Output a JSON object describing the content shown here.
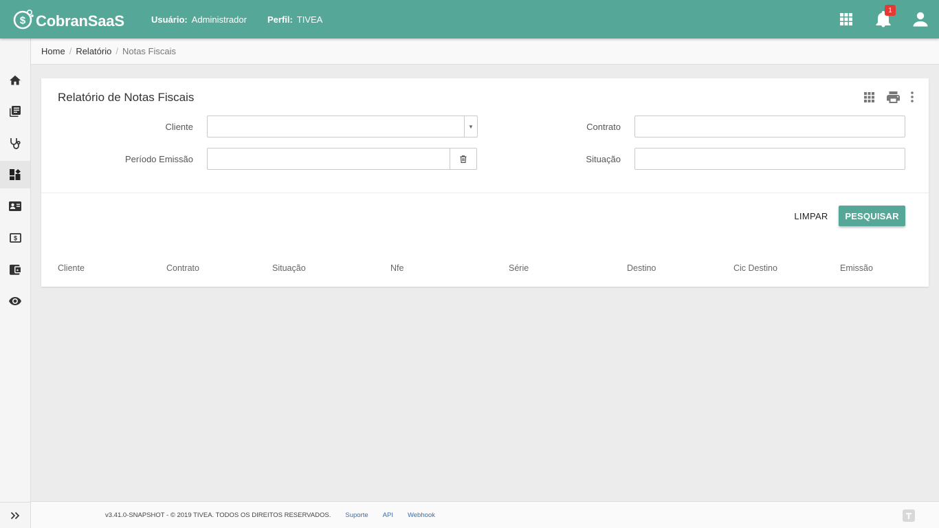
{
  "app": {
    "brand": "CobranSaaS",
    "user_label": "Usuário:",
    "user_value": "Administrador",
    "profile_label": "Perfil:",
    "profile_value": "TIVEA",
    "notification_count": "1",
    "accent_color": "#55a898"
  },
  "topbar": {
    "icons": [
      "apps-grid-icon",
      "bell-icon",
      "user-icon"
    ]
  },
  "sidebar": {
    "items": [
      {
        "icon": "home-icon"
      },
      {
        "icon": "library-books-icon"
      },
      {
        "icon": "stethoscope-icon"
      },
      {
        "icon": "dashboard-icon",
        "active": true
      },
      {
        "icon": "contact-card-icon"
      },
      {
        "icon": "money-icon"
      },
      {
        "icon": "wallet-icon"
      },
      {
        "icon": "eye-icon"
      }
    ],
    "toggle_icon": "expand-double-chevron-icon"
  },
  "breadcrumb": {
    "items": [
      "Home",
      "Relatório",
      "Notas Fiscais"
    ]
  },
  "card": {
    "title": "Relatório de Notas Fiscais",
    "tools": [
      "grid-columns-icon",
      "print-icon",
      "more-vert-icon"
    ],
    "form": {
      "cliente_label": "Cliente",
      "cliente_value": "",
      "periodo_label": "Período Emissão",
      "periodo_value": "",
      "contrato_label": "Contrato",
      "contrato_value": "",
      "situacao_label": "Situação",
      "situacao_value": ""
    },
    "buttons": {
      "limpar": "LIMPAR",
      "pesquisar": "PESQUISAR"
    },
    "table": {
      "columns": [
        "Cliente",
        "Contrato",
        "Situação",
        "Nfe",
        "Série",
        "Destino",
        "Cic Destino",
        "Emissão"
      ],
      "rows": []
    }
  },
  "footer": {
    "copyright": "v3.41.0-SNAPSHOT - © 2019 TIVEA. TODOS OS DIREITOS RESERVADOS.",
    "links": [
      "Suporte",
      "API",
      "Webhook"
    ]
  }
}
